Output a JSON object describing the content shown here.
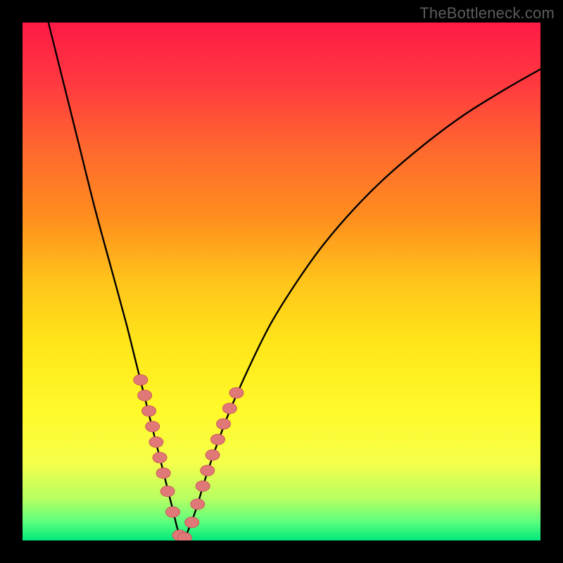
{
  "watermark": "TheBottleneck.com",
  "colors": {
    "background_black": "#000000",
    "curve_stroke": "#000000",
    "marker_fill": "#e07878",
    "marker_stroke": "#cc5a5a",
    "gradient_stops": [
      {
        "offset": 0.0,
        "color": "#ff1a47"
      },
      {
        "offset": 0.12,
        "color": "#ff3a3f"
      },
      {
        "offset": 0.25,
        "color": "#ff6a2e"
      },
      {
        "offset": 0.38,
        "color": "#ff8f1e"
      },
      {
        "offset": 0.5,
        "color": "#ffc41a"
      },
      {
        "offset": 0.62,
        "color": "#ffe61a"
      },
      {
        "offset": 0.75,
        "color": "#fffa2a"
      },
      {
        "offset": 0.85,
        "color": "#f5ff4a"
      },
      {
        "offset": 0.92,
        "color": "#b6ff62"
      },
      {
        "offset": 0.965,
        "color": "#59ff7e"
      },
      {
        "offset": 1.0,
        "color": "#00e87a"
      }
    ]
  },
  "chart_data": {
    "type": "line",
    "title": "",
    "xlabel": "",
    "ylabel": "",
    "xlim": [
      0,
      100
    ],
    "ylim": [
      0,
      100
    ],
    "series": [
      {
        "name": "bottleneck-curve",
        "x": [
          5,
          8,
          11,
          14,
          17,
          20,
          22,
          24,
          26,
          27.5,
          29,
          30,
          31,
          32,
          33.5,
          35,
          37,
          40,
          44,
          48,
          53,
          58,
          64,
          70,
          77,
          85,
          93,
          100
        ],
        "y": [
          100,
          88,
          76,
          64,
          53,
          42,
          34,
          26,
          18,
          12,
          6,
          2,
          0,
          2,
          6,
          11,
          17,
          25,
          34,
          42,
          50,
          57,
          64,
          70,
          76,
          82,
          87,
          91
        ]
      }
    ],
    "markers": {
      "name": "highlight-points",
      "x": [
        22.8,
        23.6,
        24.4,
        25.1,
        25.8,
        26.5,
        27.2,
        28.0,
        29.0,
        30.3,
        31.3,
        32.7,
        33.8,
        34.8,
        35.7,
        36.7,
        37.7,
        38.8,
        40.0,
        41.3
      ],
      "y": [
        31.0,
        28.0,
        25.0,
        22.0,
        19.0,
        16.0,
        13.0,
        9.5,
        5.5,
        1.0,
        0.5,
        3.5,
        7.0,
        10.5,
        13.5,
        16.5,
        19.5,
        22.5,
        25.5,
        28.5
      ]
    }
  }
}
